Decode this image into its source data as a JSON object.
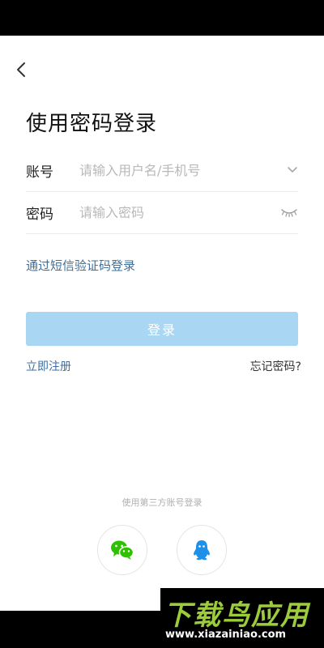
{
  "page": {
    "title": "使用密码登录"
  },
  "form": {
    "account_label": "账号",
    "account_placeholder": "请输入用户名/手机号",
    "password_label": "密码",
    "password_placeholder": "请输入密码"
  },
  "links": {
    "sms_login": "通过短信验证码登录",
    "register": "立即注册",
    "forgot_password": "忘记密码?"
  },
  "buttons": {
    "login": "登录"
  },
  "third_party": {
    "label": "使用第三方账号登录",
    "providers": [
      "wechat",
      "qq"
    ]
  },
  "icons": {
    "back": "chevron-left-icon",
    "dropdown": "chevron-down-icon",
    "password_toggle": "eye-closed-icon",
    "wechat": "wechat-icon",
    "qq": "qq-icon"
  },
  "colors": {
    "accent_link": "#3f6f9a",
    "login_button_disabled": "#a9d6f3",
    "wechat_green": "#2dc100",
    "qq_blue": "#1e90e8"
  },
  "watermark": {
    "title": "下载鸟应用",
    "url": "www.xiazainiao.com"
  }
}
